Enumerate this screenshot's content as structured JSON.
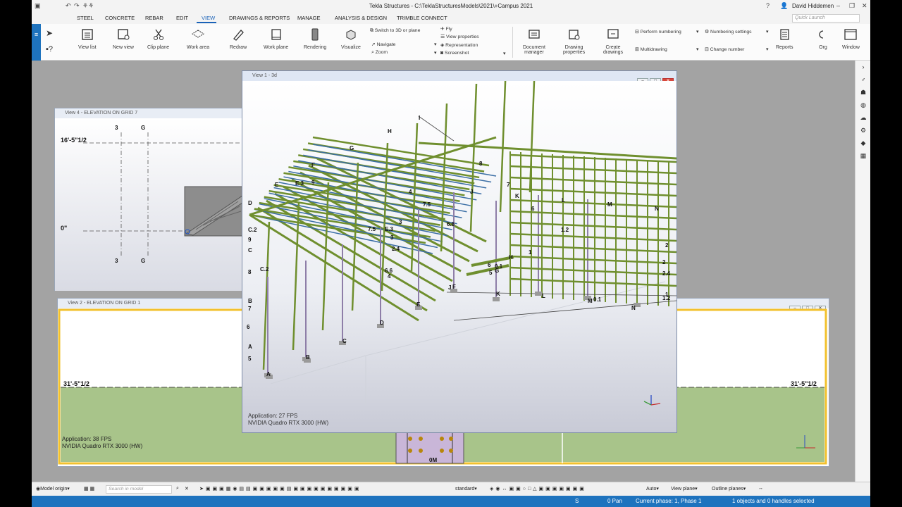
{
  "app": {
    "title": "Tekla Structures - C:\\TeklaStructuresModels\\2021\\+Campus 2021",
    "user": "David Hiddemen",
    "quick_launch_placeholder": "Quick Launch"
  },
  "menu": [
    "STEEL",
    "CONCRETE",
    "REBAR",
    "EDIT",
    "VIEW",
    "DRAWINGS & REPORTS",
    "MANAGE",
    "ANALYSIS & DESIGN",
    "TRIMBLE CONNECT"
  ],
  "menu_active": "VIEW",
  "ribbon": {
    "view_list": "View list",
    "new_view": "New view",
    "clip_plane": "Clip plane",
    "work_area": "Work area",
    "redraw": "Redraw",
    "work_plane": "Work plane",
    "rendering": "Rendering",
    "visualize": "Visualize",
    "switch_3d": "Switch to 3D or plane",
    "navigate": "Navigate",
    "zoom": "Zoom",
    "fly": "Fly",
    "view_properties": "View properties",
    "representation": "Representation",
    "screenshot": "Screenshot",
    "document_manager": [
      "Document",
      "manager"
    ],
    "drawing_properties": [
      "Drawing",
      "properties"
    ],
    "create_drawings": [
      "Create",
      "drawings"
    ],
    "perform_numbering": "Perform numbering",
    "multidrawing": "Multidrawing",
    "numbering_settings": "Numbering settings",
    "change_number": "Change number",
    "reports": "Reports",
    "org": "Org",
    "window": "Window"
  },
  "views": {
    "v4": {
      "title": "View 4 - ELEVATION ON GRID 7",
      "grids": [
        "3",
        "G"
      ],
      "elev_top": "16'-5\"1/2",
      "elev_zero": "0\""
    },
    "v2": {
      "title": "View 2 - ELEVATION ON GRID 1",
      "elev_left": "31'-5\"1/2",
      "elev_right": "31'-5\"1/2",
      "fps": "Application: 38 FPS",
      "gpu": "NVIDIA Quadro RTX 3000 (HW)",
      "bottom_label": "0M"
    },
    "v1": {
      "title": "View 1 - 3d",
      "fps": "Application: 27 FPS",
      "gpu": "NVIDIA Quadro RTX 3000 (HW)",
      "grid_labels": [
        "I",
        "H",
        "G",
        "F",
        "E",
        "E.3",
        "9",
        "D",
        "C.2",
        "9",
        "C",
        "8",
        "C.2",
        "B",
        "7",
        "6",
        "A",
        "5",
        "A",
        "B",
        "C",
        "D",
        "E",
        "F",
        "J",
        "K",
        "L",
        "M",
        "0.1",
        "N",
        "1",
        "1.2",
        "2",
        "2.4",
        "2",
        "3",
        "4",
        "N",
        "M",
        "L",
        "K",
        "J",
        "8",
        "7",
        "6",
        "7.5",
        "6.6",
        "7.5",
        "E.3",
        "3",
        "2.4",
        "6.6",
        "4",
        "1.2",
        "1",
        "6",
        "5",
        "H",
        "0.1",
        "G",
        "1"
      ]
    }
  },
  "toolbar": {
    "origin": "Model origin",
    "search_placeholder": "Search in model",
    "standard": "standard",
    "auto": "Auto",
    "view_plane": "View plane",
    "outline_planes": "Outline planes"
  },
  "status": {
    "s": "S",
    "pan": "0 Pan",
    "phase": "Current phase: 1, Phase 1",
    "selected": "1 objects and 0 handles selected"
  },
  "colors": {
    "accent": "#1e73be",
    "steel_green": "#6f8f2e",
    "steel_blue": "#3b6ea5",
    "column_purple": "#8e7ea8"
  }
}
